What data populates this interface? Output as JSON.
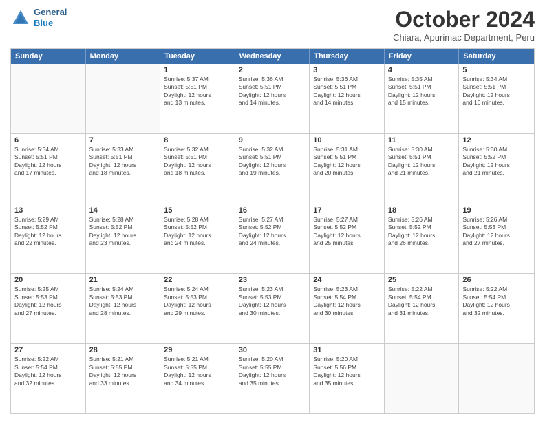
{
  "logo": {
    "line1": "General",
    "line2": "Blue"
  },
  "title": "October 2024",
  "subtitle": "Chiara, Apurimac Department, Peru",
  "header_days": [
    "Sunday",
    "Monday",
    "Tuesday",
    "Wednesday",
    "Thursday",
    "Friday",
    "Saturday"
  ],
  "weeks": [
    [
      {
        "day": "",
        "lines": []
      },
      {
        "day": "",
        "lines": []
      },
      {
        "day": "1",
        "lines": [
          "Sunrise: 5:37 AM",
          "Sunset: 5:51 PM",
          "Daylight: 12 hours",
          "and 13 minutes."
        ]
      },
      {
        "day": "2",
        "lines": [
          "Sunrise: 5:36 AM",
          "Sunset: 5:51 PM",
          "Daylight: 12 hours",
          "and 14 minutes."
        ]
      },
      {
        "day": "3",
        "lines": [
          "Sunrise: 5:36 AM",
          "Sunset: 5:51 PM",
          "Daylight: 12 hours",
          "and 14 minutes."
        ]
      },
      {
        "day": "4",
        "lines": [
          "Sunrise: 5:35 AM",
          "Sunset: 5:51 PM",
          "Daylight: 12 hours",
          "and 15 minutes."
        ]
      },
      {
        "day": "5",
        "lines": [
          "Sunrise: 5:34 AM",
          "Sunset: 5:51 PM",
          "Daylight: 12 hours",
          "and 16 minutes."
        ]
      }
    ],
    [
      {
        "day": "6",
        "lines": [
          "Sunrise: 5:34 AM",
          "Sunset: 5:51 PM",
          "Daylight: 12 hours",
          "and 17 minutes."
        ]
      },
      {
        "day": "7",
        "lines": [
          "Sunrise: 5:33 AM",
          "Sunset: 5:51 PM",
          "Daylight: 12 hours",
          "and 18 minutes."
        ]
      },
      {
        "day": "8",
        "lines": [
          "Sunrise: 5:32 AM",
          "Sunset: 5:51 PM",
          "Daylight: 12 hours",
          "and 18 minutes."
        ]
      },
      {
        "day": "9",
        "lines": [
          "Sunrise: 5:32 AM",
          "Sunset: 5:51 PM",
          "Daylight: 12 hours",
          "and 19 minutes."
        ]
      },
      {
        "day": "10",
        "lines": [
          "Sunrise: 5:31 AM",
          "Sunset: 5:51 PM",
          "Daylight: 12 hours",
          "and 20 minutes."
        ]
      },
      {
        "day": "11",
        "lines": [
          "Sunrise: 5:30 AM",
          "Sunset: 5:51 PM",
          "Daylight: 12 hours",
          "and 21 minutes."
        ]
      },
      {
        "day": "12",
        "lines": [
          "Sunrise: 5:30 AM",
          "Sunset: 5:52 PM",
          "Daylight: 12 hours",
          "and 21 minutes."
        ]
      }
    ],
    [
      {
        "day": "13",
        "lines": [
          "Sunrise: 5:29 AM",
          "Sunset: 5:52 PM",
          "Daylight: 12 hours",
          "and 22 minutes."
        ]
      },
      {
        "day": "14",
        "lines": [
          "Sunrise: 5:28 AM",
          "Sunset: 5:52 PM",
          "Daylight: 12 hours",
          "and 23 minutes."
        ]
      },
      {
        "day": "15",
        "lines": [
          "Sunrise: 5:28 AM",
          "Sunset: 5:52 PM",
          "Daylight: 12 hours",
          "and 24 minutes."
        ]
      },
      {
        "day": "16",
        "lines": [
          "Sunrise: 5:27 AM",
          "Sunset: 5:52 PM",
          "Daylight: 12 hours",
          "and 24 minutes."
        ]
      },
      {
        "day": "17",
        "lines": [
          "Sunrise: 5:27 AM",
          "Sunset: 5:52 PM",
          "Daylight: 12 hours",
          "and 25 minutes."
        ]
      },
      {
        "day": "18",
        "lines": [
          "Sunrise: 5:26 AM",
          "Sunset: 5:52 PM",
          "Daylight: 12 hours",
          "and 26 minutes."
        ]
      },
      {
        "day": "19",
        "lines": [
          "Sunrise: 5:26 AM",
          "Sunset: 5:53 PM",
          "Daylight: 12 hours",
          "and 27 minutes."
        ]
      }
    ],
    [
      {
        "day": "20",
        "lines": [
          "Sunrise: 5:25 AM",
          "Sunset: 5:53 PM",
          "Daylight: 12 hours",
          "and 27 minutes."
        ]
      },
      {
        "day": "21",
        "lines": [
          "Sunrise: 5:24 AM",
          "Sunset: 5:53 PM",
          "Daylight: 12 hours",
          "and 28 minutes."
        ]
      },
      {
        "day": "22",
        "lines": [
          "Sunrise: 5:24 AM",
          "Sunset: 5:53 PM",
          "Daylight: 12 hours",
          "and 29 minutes."
        ]
      },
      {
        "day": "23",
        "lines": [
          "Sunrise: 5:23 AM",
          "Sunset: 5:53 PM",
          "Daylight: 12 hours",
          "and 30 minutes."
        ]
      },
      {
        "day": "24",
        "lines": [
          "Sunrise: 5:23 AM",
          "Sunset: 5:54 PM",
          "Daylight: 12 hours",
          "and 30 minutes."
        ]
      },
      {
        "day": "25",
        "lines": [
          "Sunrise: 5:22 AM",
          "Sunset: 5:54 PM",
          "Daylight: 12 hours",
          "and 31 minutes."
        ]
      },
      {
        "day": "26",
        "lines": [
          "Sunrise: 5:22 AM",
          "Sunset: 5:54 PM",
          "Daylight: 12 hours",
          "and 32 minutes."
        ]
      }
    ],
    [
      {
        "day": "27",
        "lines": [
          "Sunrise: 5:22 AM",
          "Sunset: 5:54 PM",
          "Daylight: 12 hours",
          "and 32 minutes."
        ]
      },
      {
        "day": "28",
        "lines": [
          "Sunrise: 5:21 AM",
          "Sunset: 5:55 PM",
          "Daylight: 12 hours",
          "and 33 minutes."
        ]
      },
      {
        "day": "29",
        "lines": [
          "Sunrise: 5:21 AM",
          "Sunset: 5:55 PM",
          "Daylight: 12 hours",
          "and 34 minutes."
        ]
      },
      {
        "day": "30",
        "lines": [
          "Sunrise: 5:20 AM",
          "Sunset: 5:55 PM",
          "Daylight: 12 hours",
          "and 35 minutes."
        ]
      },
      {
        "day": "31",
        "lines": [
          "Sunrise: 5:20 AM",
          "Sunset: 5:56 PM",
          "Daylight: 12 hours",
          "and 35 minutes."
        ]
      },
      {
        "day": "",
        "lines": []
      },
      {
        "day": "",
        "lines": []
      }
    ]
  ]
}
